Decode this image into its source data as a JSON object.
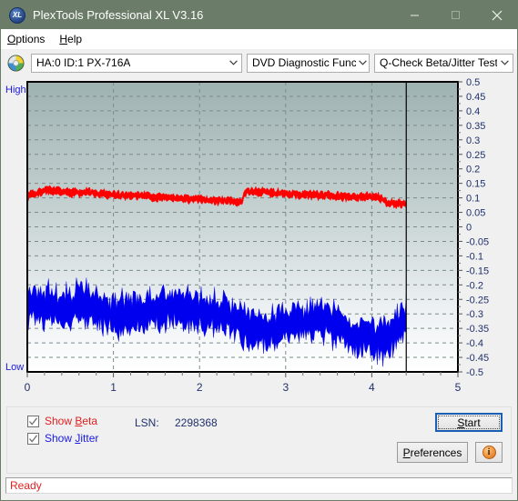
{
  "window": {
    "title": "PlexTools Professional XL V3.16",
    "app_icon": "xl-logo-icon",
    "minimize_label": "minimize-icon",
    "maximize_label": "maximize-icon",
    "close_label": "close-icon",
    "titlebar_color": "#6b7d68"
  },
  "menu": {
    "items": [
      {
        "label": "Options",
        "accel": "O",
        "rest": "ptions"
      },
      {
        "label": "Help",
        "accel": "H",
        "rest": "elp"
      }
    ]
  },
  "toolbar": {
    "drive_icon": "disc-icon",
    "drive_select": "HA:0 ID:1  PX-716A",
    "function_select": "DVD Diagnostic Functions",
    "test_select": "Q-Check Beta/Jitter Test"
  },
  "chart_labels": {
    "high": "High",
    "low": "Low"
  },
  "controls": {
    "show_beta_label_pre": "Show ",
    "show_beta_accel": "B",
    "show_beta_label_post": "eta",
    "show_beta_checked": true,
    "show_beta_color": "#e02020",
    "show_jitter_label_pre": "Show ",
    "show_jitter_accel": "J",
    "show_jitter_label_post": "itter",
    "show_jitter_checked": true,
    "show_jitter_color": "#1a1ae0",
    "lsn_label": "LSN:",
    "lsn_value": "2298368",
    "start_pre": "",
    "start_accel": "S",
    "start_post": "tart",
    "preferences_pre": "",
    "preferences_accel": "P",
    "preferences_post": "references",
    "info_glyph": "i"
  },
  "status": {
    "text": "Ready",
    "color": "#e02020"
  },
  "chart_data": {
    "type": "line",
    "title": "Q-Check Beta/Jitter Test",
    "xlabel": "",
    "ylabel": "",
    "xlim": [
      0,
      5
    ],
    "ylim": [
      -0.5,
      0.5
    ],
    "x_ticks": [
      0,
      1,
      2,
      3,
      4,
      5
    ],
    "y_ticks": [
      0.5,
      0.45,
      0.4,
      0.35,
      0.3,
      0.25,
      0.2,
      0.15,
      0.1,
      0.05,
      0,
      -0.05,
      -0.1,
      -0.15,
      -0.2,
      -0.25,
      -0.3,
      -0.35,
      -0.4,
      -0.45,
      -0.5
    ],
    "grid": true,
    "legend": [
      "Show Beta",
      "Show Jitter"
    ],
    "cursor_x": 4.4,
    "data_end_x": 4.4,
    "series": [
      {
        "name": "Beta",
        "color": "#ff0000",
        "band": 0.012,
        "x": [
          0.0,
          0.06,
          0.12,
          0.18,
          0.24,
          0.3,
          0.36,
          0.42,
          0.48,
          0.54,
          0.6,
          0.66,
          0.72,
          0.78,
          0.84,
          0.9,
          0.96,
          1.02,
          1.08,
          1.14,
          1.2,
          1.26,
          1.32,
          1.38,
          1.44,
          1.5,
          1.56,
          1.62,
          1.68,
          1.74,
          1.8,
          1.86,
          1.92,
          1.98,
          2.04,
          2.1,
          2.16,
          2.22,
          2.28,
          2.34,
          2.4,
          2.46,
          2.49,
          2.52,
          2.58,
          2.64,
          2.7,
          2.76,
          2.82,
          2.88,
          2.94,
          3.0,
          3.06,
          3.12,
          3.18,
          3.24,
          3.3,
          3.36,
          3.42,
          3.48,
          3.54,
          3.6,
          3.66,
          3.72,
          3.78,
          3.84,
          3.9,
          3.96,
          4.02,
          4.08,
          4.12,
          4.16,
          4.22,
          4.28,
          4.34,
          4.4
        ],
        "y": [
          0.105,
          0.112,
          0.118,
          0.124,
          0.128,
          0.126,
          0.122,
          0.12,
          0.118,
          0.117,
          0.119,
          0.121,
          0.12,
          0.117,
          0.114,
          0.113,
          0.112,
          0.111,
          0.11,
          0.109,
          0.108,
          0.107,
          0.106,
          0.105,
          0.104,
          0.103,
          0.102,
          0.101,
          0.1,
          0.099,
          0.098,
          0.097,
          0.096,
          0.095,
          0.094,
          0.093,
          0.092,
          0.091,
          0.09,
          0.089,
          0.088,
          0.087,
          0.086,
          0.12,
          0.122,
          0.121,
          0.12,
          0.119,
          0.118,
          0.117,
          0.116,
          0.115,
          0.114,
          0.113,
          0.112,
          0.111,
          0.11,
          0.109,
          0.108,
          0.107,
          0.106,
          0.105,
          0.105,
          0.104,
          0.104,
          0.103,
          0.103,
          0.102,
          0.102,
          0.101,
          0.1,
          0.085,
          0.083,
          0.082,
          0.08,
          0.078
        ]
      },
      {
        "name": "Jitter",
        "color": "#0000ee",
        "band": 0.055,
        "x": [
          0.0,
          0.06,
          0.12,
          0.18,
          0.24,
          0.3,
          0.36,
          0.42,
          0.48,
          0.54,
          0.6,
          0.66,
          0.72,
          0.78,
          0.84,
          0.9,
          0.96,
          1.02,
          1.08,
          1.14,
          1.2,
          1.26,
          1.32,
          1.38,
          1.44,
          1.5,
          1.56,
          1.62,
          1.68,
          1.74,
          1.8,
          1.86,
          1.92,
          1.98,
          2.04,
          2.1,
          2.16,
          2.22,
          2.28,
          2.34,
          2.4,
          2.46,
          2.52,
          2.58,
          2.64,
          2.7,
          2.76,
          2.82,
          2.88,
          2.94,
          3.0,
          3.06,
          3.12,
          3.18,
          3.24,
          3.3,
          3.36,
          3.42,
          3.48,
          3.54,
          3.6,
          3.66,
          3.72,
          3.78,
          3.84,
          3.9,
          3.96,
          4.02,
          4.08,
          4.14,
          4.2,
          4.26,
          4.32,
          4.38,
          4.4
        ],
        "y": [
          -0.275,
          -0.268,
          -0.262,
          -0.27,
          -0.268,
          -0.272,
          -0.278,
          -0.282,
          -0.28,
          -0.272,
          -0.266,
          -0.262,
          -0.264,
          -0.27,
          -0.282,
          -0.292,
          -0.3,
          -0.305,
          -0.302,
          -0.3,
          -0.298,
          -0.3,
          -0.302,
          -0.3,
          -0.296,
          -0.292,
          -0.288,
          -0.285,
          -0.283,
          -0.282,
          -0.28,
          -0.278,
          -0.28,
          -0.284,
          -0.288,
          -0.292,
          -0.296,
          -0.3,
          -0.305,
          -0.312,
          -0.32,
          -0.33,
          -0.342,
          -0.352,
          -0.358,
          -0.362,
          -0.36,
          -0.356,
          -0.352,
          -0.348,
          -0.344,
          -0.34,
          -0.336,
          -0.332,
          -0.328,
          -0.325,
          -0.324,
          -0.326,
          -0.33,
          -0.336,
          -0.344,
          -0.352,
          -0.36,
          -0.368,
          -0.376,
          -0.382,
          -0.388,
          -0.392,
          -0.394,
          -0.39,
          -0.38,
          -0.362,
          -0.34,
          -0.322,
          -0.318
        ]
      }
    ]
  }
}
